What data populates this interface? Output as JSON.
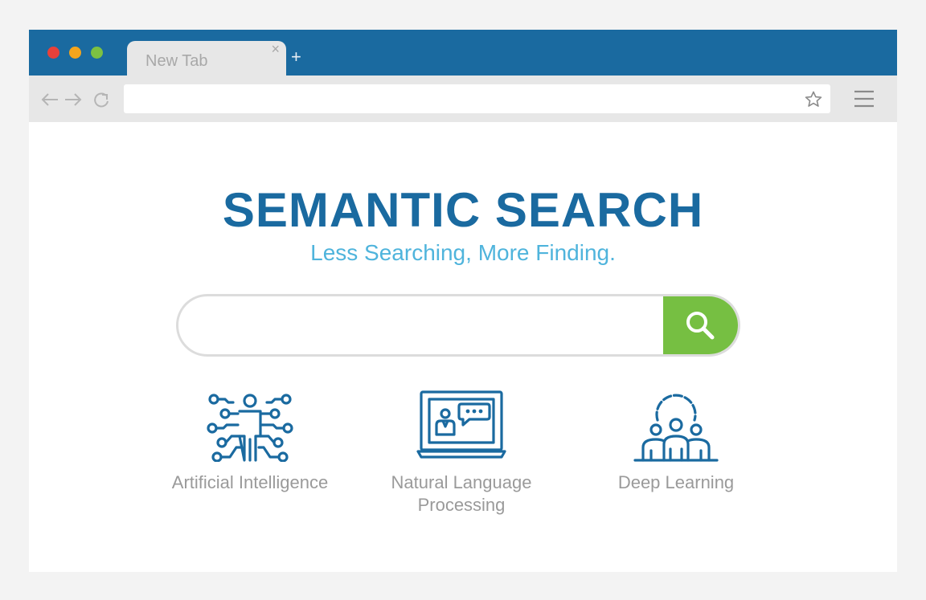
{
  "browser": {
    "tab_title": "New Tab",
    "tab_close": "×",
    "new_tab": "+",
    "address_value": ""
  },
  "page": {
    "title": "SEMANTIC SEARCH",
    "subtitle": "Less Searching, More Finding.",
    "search_placeholder": ""
  },
  "features": [
    {
      "label": "Artificial Intelligence",
      "icon": "ai-person-circuit-icon"
    },
    {
      "label": "Natural Language Processing",
      "label_line1": "Natural Language",
      "label_line2": "Processing",
      "icon": "laptop-chat-icon"
    },
    {
      "label": "Deep Learning",
      "icon": "team-learning-icon"
    }
  ],
  "colors": {
    "titlebar": "#1a6aa0",
    "title": "#1a6aa0",
    "subtitle": "#4fb4dc",
    "search_button": "#76bf42",
    "feature_label": "#9a9a9a"
  }
}
